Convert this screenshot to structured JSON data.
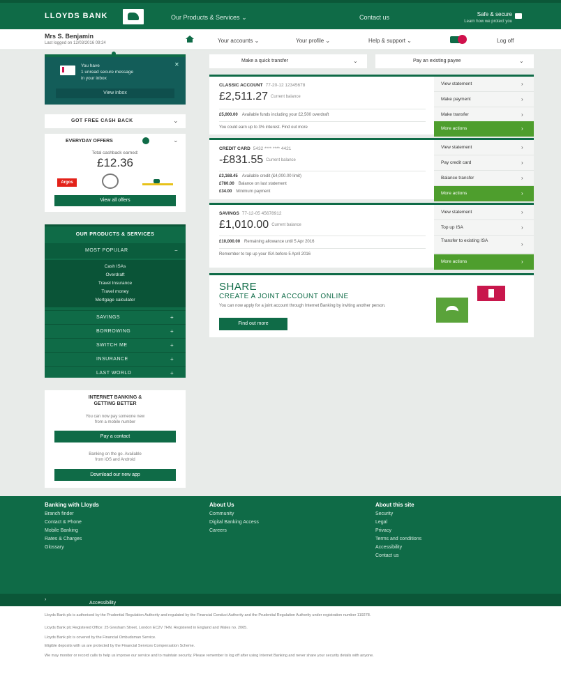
{
  "header": {
    "logo": "LLOYDS BANK",
    "nav_products": "Our Products & Services",
    "nav_contact": "Contact us",
    "secure_1": "Safe & secure",
    "secure_2": "Learn how we protect you"
  },
  "user": {
    "name": "Mrs S. Benjamin",
    "last_logon": "Last logged on 12/03/2016 09:24"
  },
  "subnav": {
    "accounts": "Your accounts",
    "profile": "Your profile",
    "help": "Help & support",
    "logoff": "Log off"
  },
  "message": {
    "text_1": "You have",
    "text_2": "1 unread secure message",
    "text_3": "in your inbox",
    "button": "View inbox"
  },
  "got_bar": {
    "label": "GOT FREE CASH BACK",
    "icon": "chevron-down-icon"
  },
  "cashback": {
    "title": "EVERYDAY OFFERS",
    "earned": "Total cashback earned:",
    "amount": "£12.36",
    "logo_1": "Argos",
    "button": "View all offers"
  },
  "products": {
    "title": "OUR PRODUCTS & SERVICES",
    "most_popular": "MOST POPULAR",
    "popular_items": [
      "Cash ISAs",
      "Overdraft",
      "Travel Insurance",
      "Travel money",
      "Mortgage calculator"
    ],
    "rows": [
      "SAVINGS",
      "BORROWING",
      "SWITCH ME",
      "INSURANCE",
      "LAST WORLD"
    ]
  },
  "internet_banking": {
    "title_1": "INTERNET BANKING &",
    "title_2": "GETTING BETTER",
    "desc_1": "You can now pay someone new",
    "desc_2": "from a mobile number",
    "button_1": "Pay a contact",
    "desc_3": "Banking on the go. Available",
    "desc_4": "from iOS and Android",
    "button_2": "Download our new app"
  },
  "selects": {
    "transfer": "Make a quick transfer",
    "payment": "Pay an existing payee"
  },
  "accounts": [
    {
      "name": "CLASSIC ACCOUNT",
      "detail": "77-20-12 12345678",
      "balance": "£2,511.27",
      "balance_label": "Current balance",
      "lines": [
        {
          "label": "£5,000.00",
          "text": "Available funds including your £2,500 overdraft"
        },
        {
          "label": "",
          "text": "You could earn up to 3% interest. Find out more"
        }
      ],
      "options": [
        "View statement",
        "Make payment",
        "Make transfer"
      ],
      "more": "More actions"
    },
    {
      "name": "CREDIT CARD",
      "detail": "5432 **** **** 4421",
      "balance": "-£831.55",
      "balance_label": "Current balance",
      "lines": [
        {
          "label": "£3,168.45",
          "text": "Available credit (£4,000.00 limit)"
        },
        {
          "label": "£780.00",
          "text": "Balance on last statement"
        },
        {
          "label": "£34.00",
          "text": "Minimum payment"
        }
      ],
      "options": [
        "View statement",
        "Pay credit card",
        "Balance transfer"
      ],
      "more": "More actions"
    },
    {
      "name": "SAVINGS",
      "detail": "77-12-05 45678912",
      "balance": "£1,010.00",
      "balance_label": "Current balance",
      "lines": [
        {
          "label": "£10,000.00",
          "text": "Remaining allowance until 5 Apr 2016"
        },
        {
          "label": "",
          "text": "Remember to top up your ISA before 5 April 2016"
        }
      ],
      "options": [
        "View statement",
        "Top up ISA",
        "Transfer to existing ISA"
      ],
      "more": "More actions"
    }
  ],
  "share": {
    "title": "SHARE",
    "subtitle": "CREATE A JOINT ACCOUNT ONLINE",
    "desc": "You can now apply for a joint account through Internet Banking by inviting another person.",
    "button": "Find out more"
  },
  "footer": {
    "col_1_title": "Banking with Lloyds",
    "col_1": [
      "Branch finder",
      "Contact & Phone",
      "Mobile Banking",
      "Rates & Charges",
      "Glossary"
    ],
    "col_2_title": "About Us",
    "col_2": [
      "Community",
      "Digital Banking Access",
      "Careers"
    ],
    "col_3_title": "About this site",
    "col_3": [
      "Security",
      "Legal",
      "Privacy",
      "Terms and conditions",
      "Accessibility",
      "Contact us"
    ],
    "bar_label": "Accessibility"
  },
  "legal": [
    "Lloyds Bank plc is authorised by the Prudential Regulation Authority and regulated by the Financial Conduct Authority and the Prudential Regulation Authority under registration number 119278.",
    "Lloyds Bank plc Registered Office: 25 Gresham Street, London EC2V 7HN. Registered in England and Wales no. 2065.",
    "Lloyds Bank plc is covered by the Financial Ombudsman Service.",
    "Eligible deposits with us are protected by the Financial Services Compensation Scheme.",
    "We may monitor or record calls to help us improve our service and to maintain security. Please remember to log off after using Internet Banking and never share your security details with anyone."
  ],
  "colors": {
    "primary_green": "#0f6b47",
    "action_green": "#4e9e2d",
    "accent_pink": "#d0114c"
  }
}
